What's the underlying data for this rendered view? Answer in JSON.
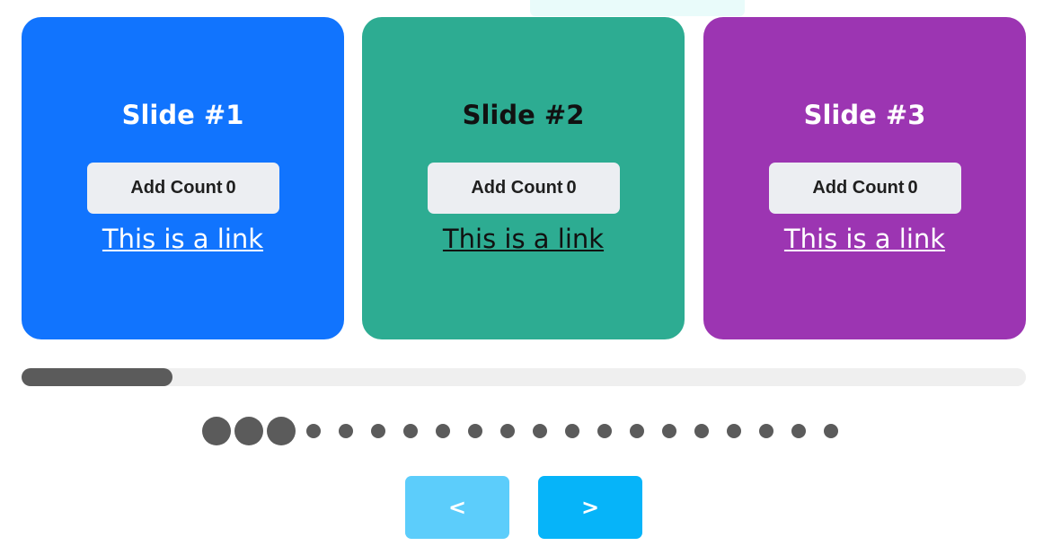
{
  "colors": {
    "slide_backgrounds": [
      "#1174fe",
      "#2dac92",
      "#9c35b2"
    ],
    "slide_text": [
      "#ffffff",
      "#111111",
      "#ffffff"
    ],
    "progress_fill": "#5b5b5b",
    "progress_track": "#efefef",
    "dot": "#5b5b5b",
    "prev_button": "#5ccdfb",
    "next_button": "#06b4f9"
  },
  "slides": [
    {
      "title": "Slide #1",
      "button_label": "Add Count",
      "count": "0",
      "link_text": "This is a link"
    },
    {
      "title": "Slide #2",
      "button_label": "Add Count",
      "count": "0",
      "link_text": "This is a link"
    },
    {
      "title": "Slide #3",
      "button_label": "Add Count",
      "count": "0",
      "link_text": "This is a link"
    }
  ],
  "progress": {
    "fraction": 0.15
  },
  "pagination": {
    "total": 20,
    "large_dots": 3
  },
  "navigation": {
    "prev_label": "<",
    "next_label": ">"
  },
  "icons": {
    "pagination": "dot-icon"
  }
}
